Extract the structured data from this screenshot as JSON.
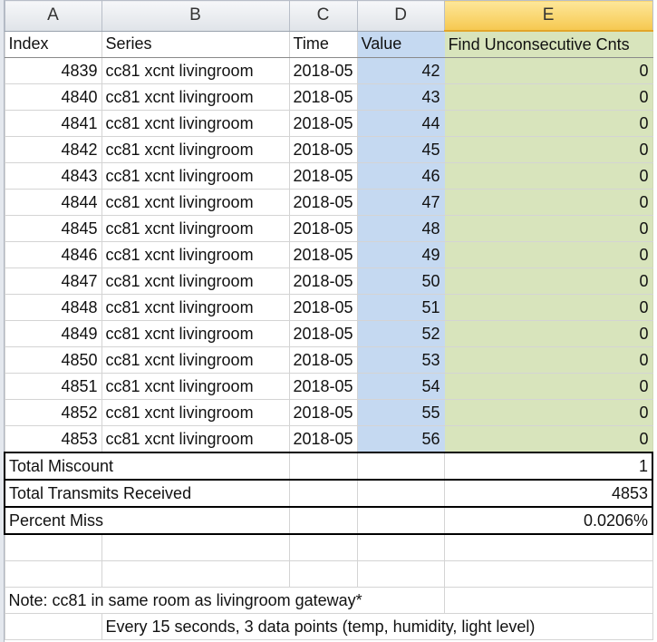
{
  "column_headers": [
    "A",
    "B",
    "C",
    "D",
    "E"
  ],
  "header_row": {
    "a": "Index",
    "b": "Series",
    "c": "Time",
    "d": "Value",
    "e": "Find Unconsecutive Cnts"
  },
  "rows": [
    {
      "index": "4839",
      "series": "cc81 xcnt livingroom",
      "time": "2018-05",
      "value": "42",
      "cnt": "0"
    },
    {
      "index": "4840",
      "series": "cc81 xcnt livingroom",
      "time": "2018-05",
      "value": "43",
      "cnt": "0"
    },
    {
      "index": "4841",
      "series": "cc81 xcnt livingroom",
      "time": "2018-05",
      "value": "44",
      "cnt": "0"
    },
    {
      "index": "4842",
      "series": "cc81 xcnt livingroom",
      "time": "2018-05",
      "value": "45",
      "cnt": "0"
    },
    {
      "index": "4843",
      "series": "cc81 xcnt livingroom",
      "time": "2018-05",
      "value": "46",
      "cnt": "0"
    },
    {
      "index": "4844",
      "series": "cc81 xcnt livingroom",
      "time": "2018-05",
      "value": "47",
      "cnt": "0"
    },
    {
      "index": "4845",
      "series": "cc81 xcnt livingroom",
      "time": "2018-05",
      "value": "48",
      "cnt": "0"
    },
    {
      "index": "4846",
      "series": "cc81 xcnt livingroom",
      "time": "2018-05",
      "value": "49",
      "cnt": "0"
    },
    {
      "index": "4847",
      "series": "cc81 xcnt livingroom",
      "time": "2018-05",
      "value": "50",
      "cnt": "0"
    },
    {
      "index": "4848",
      "series": "cc81 xcnt livingroom",
      "time": "2018-05",
      "value": "51",
      "cnt": "0"
    },
    {
      "index": "4849",
      "series": "cc81 xcnt livingroom",
      "time": "2018-05",
      "value": "52",
      "cnt": "0"
    },
    {
      "index": "4850",
      "series": "cc81 xcnt livingroom",
      "time": "2018-05",
      "value": "53",
      "cnt": "0"
    },
    {
      "index": "4851",
      "series": "cc81 xcnt livingroom",
      "time": "2018-05",
      "value": "54",
      "cnt": "0"
    },
    {
      "index": "4852",
      "series": "cc81 xcnt livingroom",
      "time": "2018-05",
      "value": "55",
      "cnt": "0"
    },
    {
      "index": "4853",
      "series": "cc81 xcnt livingroom",
      "time": "2018-05",
      "value": "56",
      "cnt": "0"
    }
  ],
  "summary": [
    {
      "label": "Total Miscount",
      "value": "1"
    },
    {
      "label": "Total Transmits Received",
      "value": "4853"
    },
    {
      "label": "Percent Miss",
      "value": "0.0206%"
    }
  ],
  "notes": {
    "note": "Note:  cc81 in same room as livingroom gateway*",
    "detail": "Every 15 seconds, 3 data points (temp, humidity, light level)"
  }
}
